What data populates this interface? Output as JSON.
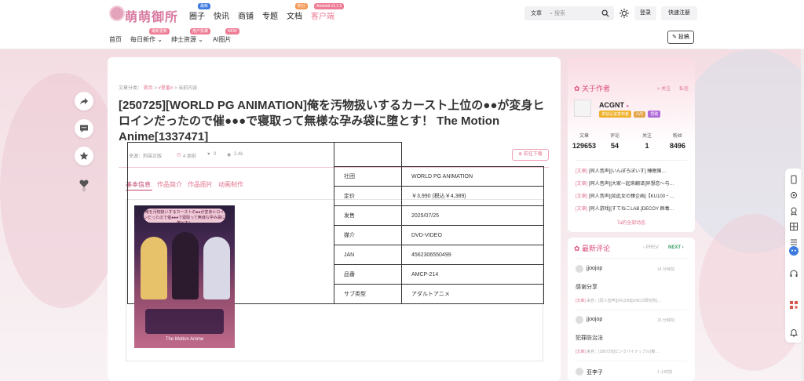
{
  "header": {
    "logo_text": "萌萌御所",
    "nav": [
      {
        "label": "圈子",
        "badge": "最新",
        "badge_color": "blue"
      },
      {
        "label": "快讯",
        "badge": "",
        "badge_color": ""
      },
      {
        "label": "商铺",
        "badge": "",
        "badge_color": ""
      },
      {
        "label": "专题",
        "badge": "",
        "badge_color": ""
      },
      {
        "label": "文档",
        "badge": "积分",
        "badge_color": "orange"
      },
      {
        "label": "客户端",
        "badge": "Android v1.1.5",
        "badge_color": "pink"
      }
    ],
    "search": {
      "type": "文章",
      "placeholder": "搜索"
    },
    "login_label": "登录",
    "register_label": "快速注册"
  },
  "subnav": {
    "items": [
      {
        "label": "首页",
        "badge": ""
      },
      {
        "label": "每日新作",
        "badge": "最新更新"
      },
      {
        "label": "绅士资源",
        "badge": "用户投稿"
      },
      {
        "label": "AI图片",
        "badge": "NEW"
      }
    ],
    "post_label": "投稿"
  },
  "left_actions": {
    "like_count": "0"
  },
  "article": {
    "breadcrumb": {
      "prefix": "文章分类：",
      "home": "首页",
      "category": "#里番#",
      "current": "当前内容"
    },
    "title": "[250725][WORLD PG ANIMATION]俺を汚物扱いするカースト上位の●●が変身ヒロインだったので催●●●で寝取って無様な孕み袋に堕とす！ The Motion Anime[1337471]",
    "meta": {
      "source": "来源：狗屎正版",
      "time": "4 周前",
      "likes": "0",
      "views": "2.4k"
    },
    "goto_label": "前往下载",
    "tabs": [
      "基本信息",
      "作品简介",
      "作品图片",
      "动画制作"
    ],
    "cover_title": "俺を汚物扱いするカーストの●●が変身ヒロインだったので催●●●で寝取って無様な孕み袋に堕とす！",
    "cover_sub": "The Motion Anime",
    "info_rows": [
      {
        "key": "社团",
        "value": "WORLD PG ANIMATION"
      },
      {
        "key": "定价",
        "value": "￥3,990 (税込￥4,389)"
      },
      {
        "key": "发售",
        "value": "2025/07/25"
      },
      {
        "key": "媒介",
        "value": "DVD-VIDEO"
      },
      {
        "key": "JAN",
        "value": "4562306550499"
      },
      {
        "key": "品番",
        "value": "AMCP-214"
      },
      {
        "key": "サブ类型",
        "value": "アダルトアニメ"
      }
    ]
  },
  "author": {
    "title": "关于作者",
    "follow_label": "+ 关注",
    "message_label": "私信",
    "name": "ACGNT",
    "badges": [
      "本站认证发布者",
      "LV3",
      "赞助"
    ],
    "stats": [
      {
        "label": "文章",
        "value": "129653"
      },
      {
        "label": "评论",
        "value": "54"
      },
      {
        "label": "关注",
        "value": "1"
      },
      {
        "label": "粉丝",
        "value": "8496"
      }
    ],
    "posts": [
      {
        "tag": "[文章]",
        "text": "[同人音声][いんぽろぼいす] 睡眠陳…"
      },
      {
        "tag": "[文章]",
        "text": "[同人音声][大家一起来翻译]异想恋～与…"
      },
      {
        "tag": "[文章]",
        "text": "[同人音声][如此女の臻企画]【KU100・…"
      },
      {
        "tag": "[文章]",
        "text": "[同人游戏][すてねこLAB.]DECOY 群毒…"
      }
    ],
    "see_all": "Ta的全部动态"
  },
  "comments": {
    "title": "最新评论",
    "prev": "PREV",
    "next": "NEXT",
    "items": [
      {
        "user": "jjoojop",
        "time": "14 分钟前",
        "text": "感谢分享",
        "ref_tag": "[文章]",
        "ref": "来自：[同人音声][241230][UNCO研究所]…"
      },
      {
        "user": "jjoojop",
        "time": "15 分钟前",
        "text": "犯罪防治法",
        "ref_tag": "[文章]",
        "ref": "来自：[180729][ピンクパイナップル]俺…"
      },
      {
        "user": "亚李子",
        "time": "1 小时前",
        "text": "",
        "ref_tag": "",
        "ref": ""
      }
    ]
  },
  "colors": {
    "accent": "#e0738f",
    "accent_dark": "#c2456a",
    "bg": "#f5e9ec"
  }
}
